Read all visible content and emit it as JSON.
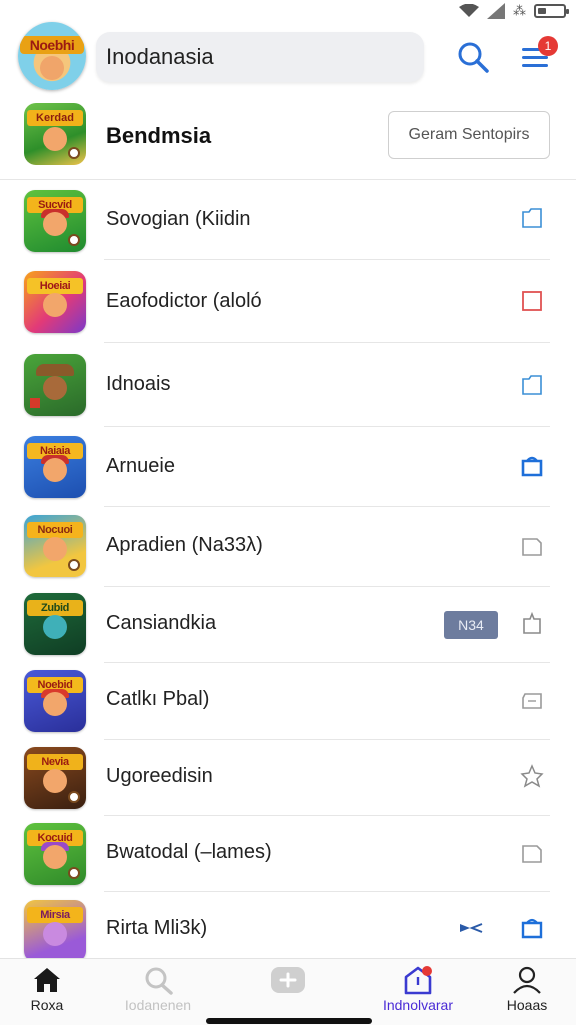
{
  "header": {
    "app_logo_text": "Noebhi",
    "search_text": "Inodanasia",
    "notification_count": "1",
    "search_icon": "search-icon",
    "menu_icon": "menu-icon"
  },
  "featured": {
    "title": "Bendmsia",
    "button_label": "Geram Sentopirs",
    "icon_text": "Kerdad"
  },
  "games": [
    {
      "label": "Sovogian (Kiidin",
      "icon_text": "Sucvid",
      "action": "folder-outline-icon"
    },
    {
      "label": "Eaofodictor (aloló",
      "icon_text": "Hoeiai",
      "action": "square-red-icon"
    },
    {
      "label": "Idnoais",
      "icon_text": "",
      "action": "folder-outline-icon"
    },
    {
      "label": "Arnueie",
      "icon_text": "Naiaia",
      "action": "bag-solid-icon"
    },
    {
      "label": "Apradien (Na33λ)",
      "icon_text": "Nocuoi",
      "action": "folder-grey-icon"
    },
    {
      "label": "Cansiandkia",
      "icon_text": "Zubid",
      "action": "bookmark-icon",
      "tag": "N34"
    },
    {
      "label": "Catlkı Pbal)",
      "icon_text": "Noebid",
      "action": "ticket-icon"
    },
    {
      "label": "Ugoreedisin",
      "icon_text": "Nevia",
      "action": "star-outline-icon"
    },
    {
      "label": "Bwatodal (–lames)",
      "icon_text": "Kocuid",
      "action": "folder-grey-icon"
    },
    {
      "label": "Rirta Mli3k)",
      "icon_text": "Mirsia",
      "action": "bag-outline-blue-icon",
      "extra": "pinch-icon"
    }
  ],
  "bottom_nav": [
    {
      "label": "Roxa",
      "icon": "home-icon"
    },
    {
      "label": "Iodanenen",
      "icon": "search-refresh-icon"
    },
    {
      "label": "",
      "icon": "add-icon"
    },
    {
      "label": "Indnolvarar",
      "icon": "notification-home-icon"
    },
    {
      "label": "Hoaas",
      "icon": "profile-icon"
    }
  ],
  "colors": {
    "accent_blue": "#2a6fd6",
    "active_nav": "#4a2bd6",
    "badge_red": "#e53935",
    "inactive_nav": "#bdbdbd"
  }
}
